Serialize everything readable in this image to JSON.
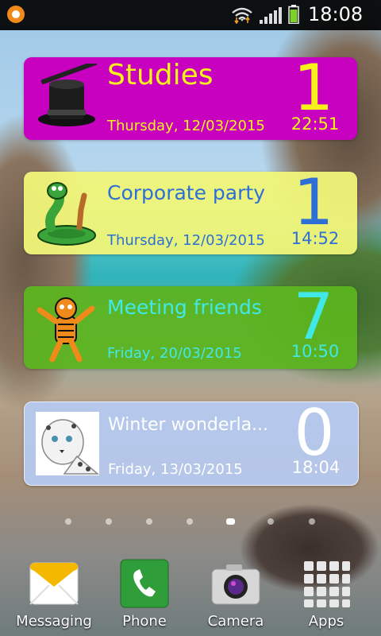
{
  "status_bar": {
    "time": "18:08"
  },
  "events": [
    {
      "title": "Studies",
      "date": "Thursday, 12/03/2015",
      "count": "1",
      "clock": "22:51",
      "bg": "#c800c0",
      "fg": "#f6f21a",
      "icon": "magic-hat-icon"
    },
    {
      "title": "Corporate party",
      "date": "Thursday, 12/03/2015",
      "count": "1",
      "clock": "14:52",
      "bg": "#ecf27a",
      "fg": "#2d6fd6",
      "icon": "snake-icon"
    },
    {
      "title": "Meeting friends",
      "date": "Friday, 20/03/2015",
      "count": "7",
      "clock": "10:50",
      "bg": "#5cb420",
      "fg": "#41e8e8",
      "icon": "tiger-icon"
    },
    {
      "title": "Winter wonderla...",
      "date": "Friday, 13/03/2015",
      "count": "0",
      "clock": "18:04",
      "bg": "#b5c9ef",
      "fg": "#ffffff",
      "icon": "snow-leopard-icon"
    }
  ],
  "page_indicator": {
    "pages": 7,
    "current": 5
  },
  "dock": [
    {
      "label": "Messaging",
      "icon": "messaging-icon"
    },
    {
      "label": "Phone",
      "icon": "phone-icon"
    },
    {
      "label": "Camera",
      "icon": "camera-icon"
    },
    {
      "label": "Apps",
      "icon": "apps-grid-icon"
    }
  ]
}
